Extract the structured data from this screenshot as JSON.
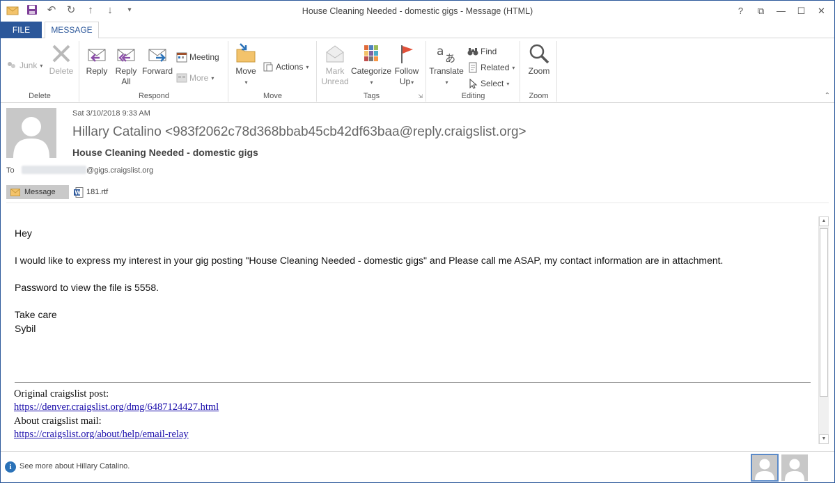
{
  "window": {
    "title": "House Cleaning Needed - domestic gigs - Message (HTML)",
    "controls": {
      "help": "?",
      "restore_ribbon": "⧉",
      "minimize": "—",
      "maximize": "☐",
      "close": "✕"
    }
  },
  "tabs": {
    "file": "FILE",
    "message": "MESSAGE"
  },
  "ribbon": {
    "delete_group": {
      "label": "Delete",
      "junk": "Junk",
      "delete": "Delete"
    },
    "respond_group": {
      "label": "Respond",
      "reply": "Reply",
      "reply_all_1": "Reply",
      "reply_all_2": "All",
      "forward": "Forward",
      "meeting": "Meeting",
      "more": "More"
    },
    "move_group": {
      "label": "Move",
      "move": "Move",
      "actions": "Actions"
    },
    "tags_group": {
      "label": "Tags",
      "mark_unread_1": "Mark",
      "mark_unread_2": "Unread",
      "categorize": "Categorize",
      "follow_up_1": "Follow",
      "follow_up_2": "Up"
    },
    "editing_group": {
      "label": "Editing",
      "translate": "Translate",
      "find": "Find",
      "related": "Related",
      "select": "Select"
    },
    "zoom_group": {
      "label": "Zoom",
      "zoom": "Zoom"
    }
  },
  "header": {
    "date": "Sat 3/10/2018 9:33 AM",
    "sender": "Hillary Catalino <983f2062c78d368bbab45cb42df63baa@reply.craigslist.org>",
    "subject": "House Cleaning Needed - domestic gigs",
    "to_label": "To",
    "to_domain": "@gigs.craigslist.org",
    "message_tab": "Message",
    "attachment": "181.rtf"
  },
  "body": {
    "greeting": "Hey",
    "para1": "I would like to express my interest in your gig posting \"House Cleaning Needed - domestic gigs\" and Please call me ASAP, my contact information are in attachment.",
    "para2": "Password to view the file is 5558.",
    "signoff": "Take care",
    "name": "Sybil",
    "orig_label": "Original craigslist post:",
    "orig_link": "https://denver.craigslist.org/dmg/6487124427.html",
    "about_label": "About craigslist mail:",
    "about_link": "https://craigslist.org/about/help/email-relay"
  },
  "footer": {
    "info": "See more about Hillary Catalino."
  },
  "colors": {
    "accent": "#2b579a",
    "link": "#1a0dab"
  }
}
